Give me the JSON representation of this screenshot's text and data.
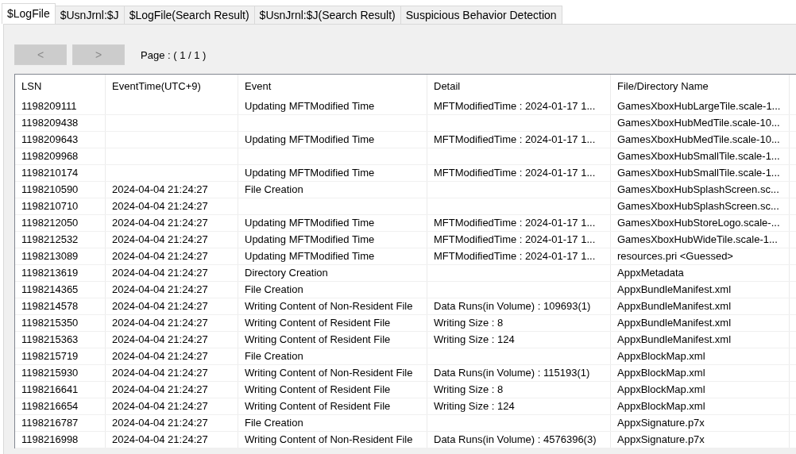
{
  "tabs": [
    {
      "label": "$LogFile",
      "selected": true
    },
    {
      "label": "$UsnJrnl:$J",
      "selected": false
    },
    {
      "label": "$LogFile(Search Result)",
      "selected": false
    },
    {
      "label": "$UsnJrnl:$J(Search Result)",
      "selected": false
    },
    {
      "label": "Suspicious Behavior Detection",
      "selected": false
    }
  ],
  "pager": {
    "prev": {
      "label": "<",
      "disabled": true
    },
    "next": {
      "label": ">",
      "disabled": true
    },
    "page": "Page : ( 1 / 1 )"
  },
  "table": {
    "columns": [
      "LSN",
      "EventTime(UTC+9)",
      "Event",
      "Detail",
      "File/Directory Name"
    ],
    "rows": [
      [
        "1198209111",
        "",
        "Updating MFTModified Time",
        "MFTModifiedTime : 2024-01-17 1...",
        "GamesXboxHubLargeTile.scale-1..."
      ],
      [
        "1198209438",
        "",
        "",
        "",
        "GamesXboxHubMedTile.scale-10..."
      ],
      [
        "1198209643",
        "",
        "Updating MFTModified Time",
        "MFTModifiedTime : 2024-01-17 1...",
        "GamesXboxHubMedTile.scale-10..."
      ],
      [
        "1198209968",
        "",
        "",
        "",
        "GamesXboxHubSmallTile.scale-1..."
      ],
      [
        "1198210174",
        "",
        "Updating MFTModified Time",
        "MFTModifiedTime : 2024-01-17 1...",
        "GamesXboxHubSmallTile.scale-1..."
      ],
      [
        "1198210590",
        "2024-04-04 21:24:27",
        "File Creation",
        "",
        "GamesXboxHubSplashScreen.sc..."
      ],
      [
        "1198210710",
        "2024-04-04 21:24:27",
        "",
        "",
        "GamesXboxHubSplashScreen.sc..."
      ],
      [
        "1198212050",
        "2024-04-04 21:24:27",
        "Updating MFTModified Time",
        "MFTModifiedTime : 2024-01-17 1...",
        "GamesXboxHubStoreLogo.scale-..."
      ],
      [
        "1198212532",
        "2024-04-04 21:24:27",
        "Updating MFTModified Time",
        "MFTModifiedTime : 2024-01-17 1...",
        "GamesXboxHubWideTile.scale-1..."
      ],
      [
        "1198213089",
        "2024-04-04 21:24:27",
        "Updating MFTModified Time",
        "MFTModifiedTime : 2024-01-17 1...",
        "resources.pri <Guessed>"
      ],
      [
        "1198213619",
        "2024-04-04 21:24:27",
        "Directory Creation",
        "",
        "AppxMetadata"
      ],
      [
        "1198214365",
        "2024-04-04 21:24:27",
        "File Creation",
        "",
        "AppxBundleManifest.xml"
      ],
      [
        "1198214578",
        "2024-04-04 21:24:27",
        "Writing Content of Non-Resident File",
        "Data Runs(in Volume) : 109693(1)",
        "AppxBundleManifest.xml"
      ],
      [
        "1198215350",
        "2024-04-04 21:24:27",
        "Writing Content of Resident File",
        "Writing Size : 8",
        "AppxBundleManifest.xml"
      ],
      [
        "1198215363",
        "2024-04-04 21:24:27",
        "Writing Content of Resident File",
        "Writing Size : 124",
        "AppxBundleManifest.xml"
      ],
      [
        "1198215719",
        "2024-04-04 21:24:27",
        "File Creation",
        "",
        "AppxBlockMap.xml"
      ],
      [
        "1198215930",
        "2024-04-04 21:24:27",
        "Writing Content of Non-Resident File",
        "Data Runs(in Volume) : 115193(1)",
        "AppxBlockMap.xml"
      ],
      [
        "1198216641",
        "2024-04-04 21:24:27",
        "Writing Content of Resident File",
        "Writing Size : 8",
        "AppxBlockMap.xml"
      ],
      [
        "1198216654",
        "2024-04-04 21:24:27",
        "Writing Content of Resident File",
        "Writing Size : 124",
        "AppxBlockMap.xml"
      ],
      [
        "1198216787",
        "2024-04-04 21:24:27",
        "File Creation",
        "",
        "AppxSignature.p7x"
      ],
      [
        "1198216998",
        "2024-04-04 21:24:27",
        "Writing Content of Non-Resident File",
        "Data Runs(in Volume) : 4576396(3)",
        "AppxSignature.p7x"
      ]
    ]
  }
}
